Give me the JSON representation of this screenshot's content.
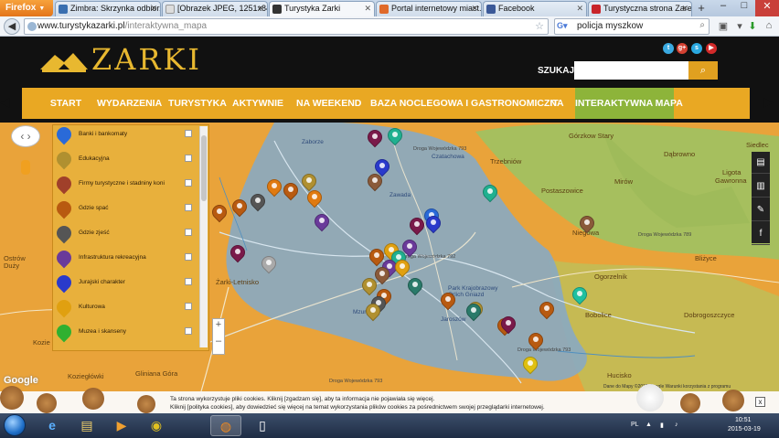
{
  "browser": {
    "app_button": "Firefox",
    "tabs": [
      {
        "label": "Zimbra: Skrzynka odbior...",
        "fav_color": "#3a6fb0"
      },
      {
        "label": "[Obrazek JPEG, 1251x843 ...",
        "fav_color": "#dddddd"
      },
      {
        "label": "Turystyka Zarki",
        "fav_color": "#333333",
        "active": true
      },
      {
        "label": "Portal internetowy miast...",
        "fav_color": "#e06a2a"
      },
      {
        "label": "Facebook",
        "fav_color": "#3b5998"
      },
      {
        "label": "Turystyczna strona Zarek...",
        "fav_color": "#c8242a"
      }
    ],
    "new_tab": "+",
    "window_controls": [
      "–",
      "□",
      "✕"
    ],
    "url_host": "www.turystykazarki.pl",
    "url_path": "/interaktywna_mapa",
    "search_value": "policja myszkow",
    "search_engine_icon": "google-icon",
    "back_icon": "back-arrow-icon"
  },
  "site": {
    "logo_text": "ZARKI",
    "search_label": "SZUKAJ",
    "search_placeholder": "",
    "search_button_icon": "magnifier-icon",
    "social_icons": [
      {
        "name": "twitter-icon",
        "glyph": "t",
        "color": "#3aa9e0"
      },
      {
        "name": "google-plus-icon",
        "glyph": "g+",
        "color": "#d44132"
      },
      {
        "name": "skype-icon",
        "glyph": "s",
        "color": "#2aa8e0"
      },
      {
        "name": "youtube-icon",
        "glyph": "▶",
        "color": "#d22a2a"
      }
    ],
    "menu": [
      {
        "label": "START",
        "active": false
      },
      {
        "label": "WYDARZENIA",
        "active": false
      },
      {
        "label": "TURYSTYKA",
        "active": false
      },
      {
        "label": "AKTYWNIE",
        "active": false
      },
      {
        "label": "NA WEEKEND",
        "active": false
      },
      {
        "label": "BAZA NOCLEGOWA I GASTRONOMICZNA",
        "active": false
      },
      {
        "label": "IT",
        "active": false
      },
      {
        "label": "INTERAKTYWNA MAPA",
        "active": true
      }
    ],
    "accent_color": "#e9a823",
    "active_menu_color": "#8db43a"
  },
  "map": {
    "filters": [
      {
        "label": "Banki i bankomaty",
        "color": "#2a6ad8"
      },
      {
        "label": "Edukacyjna",
        "color": "#b09030"
      },
      {
        "label": "Firmy turystyczne i stadniny koni",
        "color": "#a0402a"
      },
      {
        "label": "Gdzie spać",
        "color": "#b85a10"
      },
      {
        "label": "Gdzie zjeść",
        "color": "#555555"
      },
      {
        "label": "Infrastruktura rekreacyjna",
        "color": "#6a3a9a"
      },
      {
        "label": "Jurajski charakter",
        "color": "#2a3acb"
      },
      {
        "label": "Kulturowa",
        "color": "#e0a010"
      },
      {
        "label": "Muzea i skanseny",
        "color": "#30b030"
      }
    ],
    "place_labels": [
      {
        "text": "Zaborze",
        "kind": "blue"
      },
      {
        "text": "Górzkow Stary",
        "kind": "plain"
      },
      {
        "text": "Siedlec",
        "kind": "plain"
      },
      {
        "text": "Czatachowa",
        "kind": "blue"
      },
      {
        "text": "Trzebniów",
        "kind": "plain"
      },
      {
        "text": "Dąbrowno",
        "kind": "plain"
      },
      {
        "text": "Ligota",
        "kind": "plain"
      },
      {
        "text": "Gawronna",
        "kind": "plain"
      },
      {
        "text": "Mirów",
        "kind": "plain"
      },
      {
        "text": "Postaszowice",
        "kind": "plain"
      },
      {
        "text": "Niegowa",
        "kind": "plain"
      },
      {
        "text": "Zawada",
        "kind": "blue"
      },
      {
        "text": "Żarki-Letnisko",
        "kind": "plain"
      },
      {
        "text": "Ogorzelnik",
        "kind": "plain"
      },
      {
        "text": "Bliżyce",
        "kind": "plain"
      },
      {
        "text": "Bobolice",
        "kind": "plain"
      },
      {
        "text": "Dobrogoszczyce",
        "kind": "plain"
      },
      {
        "text": "Koziegłówki",
        "kind": "plain"
      },
      {
        "text": "Gliniana Góra",
        "kind": "plain"
      },
      {
        "text": "Hucisko",
        "kind": "plain"
      },
      {
        "text": "Kozie",
        "kind": "plain"
      },
      {
        "text": "Ostrów",
        "kind": "plain"
      },
      {
        "text": "Duży",
        "kind": "plain"
      },
      {
        "text": "Park Krajobrazowy Orlich Gniazd",
        "kind": "blue"
      },
      {
        "text": "Mzurów",
        "kind": "blue"
      },
      {
        "text": "Jaroszów",
        "kind": "blue"
      }
    ],
    "road_labels": [
      "Droga Wojewódzka 793",
      "Droga Wojewódzka 792",
      "Droga Wojewódzka 789",
      "Droga Wojewódzka 793",
      "Droga Wojewódzka 793"
    ],
    "google_logo": "Google",
    "attribution": "Dane do Mapy ©2015 Google   Warunki korzystania z programu",
    "pins": [
      {
        "color": "#7a1a4a"
      },
      {
        "color": "#20b090"
      },
      {
        "color": "#2a3acb"
      },
      {
        "color": "#8a5a3a"
      },
      {
        "color": "#e07a10"
      },
      {
        "color": "#b85a10"
      },
      {
        "color": "#b09030"
      },
      {
        "color": "#e07a10"
      },
      {
        "color": "#555555"
      },
      {
        "color": "#b85a10"
      },
      {
        "color": "#b85a10"
      },
      {
        "color": "#6a3a9a"
      },
      {
        "color": "#7a1a4a"
      },
      {
        "color": "#aaaaaa"
      },
      {
        "color": "#2a6ad8"
      },
      {
        "color": "#2a3acb"
      },
      {
        "color": "#7a1a4a"
      },
      {
        "color": "#6a3a9a"
      },
      {
        "color": "#e0a010"
      },
      {
        "color": "#b85a10"
      },
      {
        "color": "#20b090"
      },
      {
        "color": "#6a3a9a"
      },
      {
        "color": "#e0a010"
      },
      {
        "color": "#8a5a3a"
      },
      {
        "color": "#b09030"
      },
      {
        "color": "#b85a10"
      },
      {
        "color": "#555555"
      },
      {
        "color": "#2a7a6a"
      },
      {
        "color": "#20b090"
      },
      {
        "color": "#b85a10"
      },
      {
        "color": "#b85a10"
      },
      {
        "color": "#b09030"
      },
      {
        "color": "#7a1a4a"
      },
      {
        "color": "#b85a10"
      },
      {
        "color": "#e0c010"
      },
      {
        "color": "#20c0a0"
      },
      {
        "color": "#2a7a6a"
      },
      {
        "color": "#8a5a3a"
      },
      {
        "color": "#b85a10"
      },
      {
        "color": "#b09030"
      }
    ],
    "side_icons": [
      "comment-icon",
      "chart-icon",
      "edit-icon",
      "facebook-icon"
    ]
  },
  "cookie": {
    "line1": "Ta strona wykorzystuje pliki cookies. Kliknij [zgadzam się], aby ta informacja nie pojawiała się więcej.",
    "line2": "Kliknij [polityka cookies], aby dowiedzieć się więcej na temat wykorzystania plików cookies za pośrednictwem swojej przeglądarki internetowej.",
    "close": "x"
  },
  "taskbar": {
    "apps": [
      {
        "name": "internet-explorer-icon",
        "glyph": "e"
      },
      {
        "name": "explorer-folder-icon",
        "glyph": "▤"
      },
      {
        "name": "media-player-icon",
        "glyph": "▶"
      },
      {
        "name": "chrome-icon",
        "glyph": "◉"
      },
      {
        "name": "firefox-icon",
        "glyph": "◍",
        "active": true
      },
      {
        "name": "document-icon",
        "glyph": "▯"
      }
    ],
    "language": "PL",
    "time": "10:51",
    "date": "2015-03-19"
  }
}
